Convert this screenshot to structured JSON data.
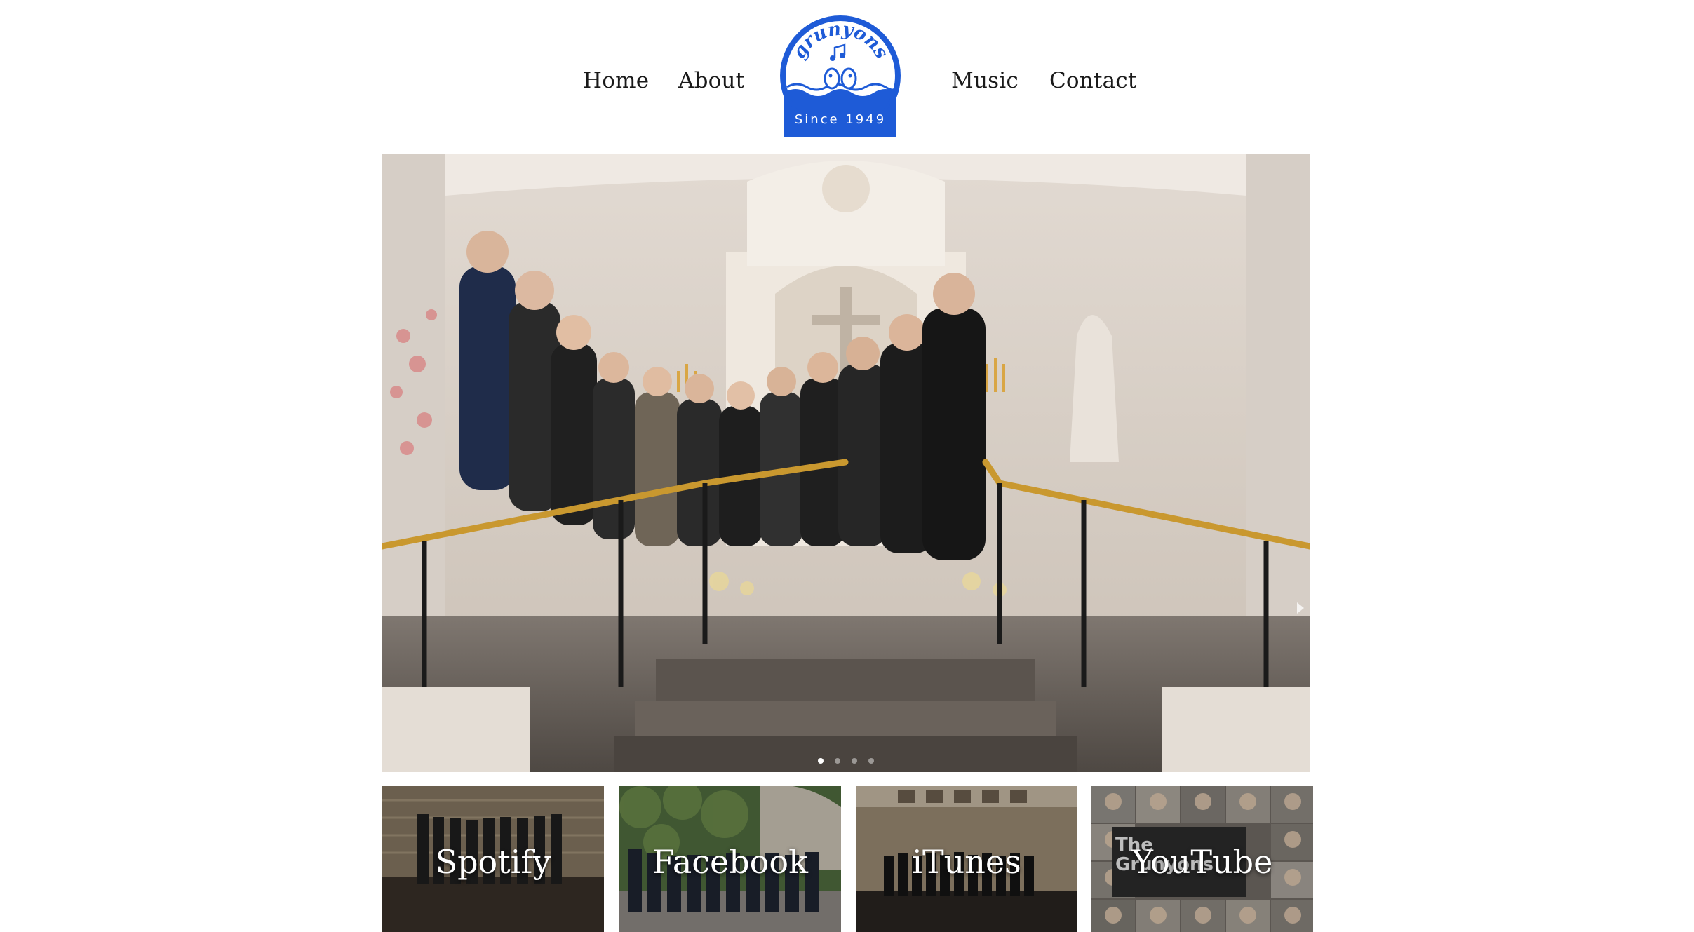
{
  "nav": {
    "home": "Home",
    "about": "About",
    "music": "Music",
    "contact": "Contact"
  },
  "logo": {
    "name": "grunyons",
    "tagline": "Since 1949",
    "color": "#1e5bd7"
  },
  "hero": {
    "slide_count": 4,
    "active_slide": 1
  },
  "tiles": [
    {
      "label": "Spotify"
    },
    {
      "label": "Facebook"
    },
    {
      "label": "iTunes"
    },
    {
      "label": "YouTube"
    }
  ],
  "tile_overlay_texts": {
    "youtube_badge": "The Grunyons"
  }
}
